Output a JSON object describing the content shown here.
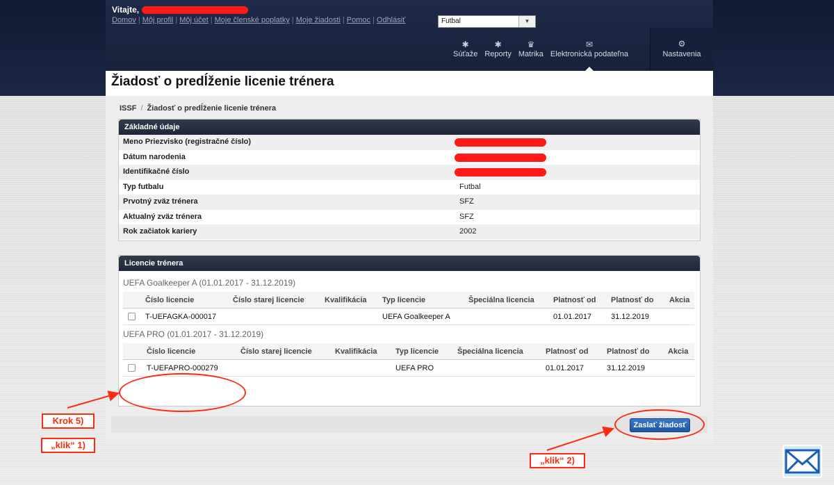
{
  "header": {
    "welcome": "Vitajte,",
    "links": [
      "Domov",
      "Môj profil",
      "Môj účet",
      "Moje členské poplatky",
      "Moje žiadosti",
      "Pomoc",
      "Odhlásiť"
    ],
    "sport_select": "Futbal"
  },
  "nav": {
    "items": [
      {
        "label": "Súťaže",
        "icon": "trophy-icon"
      },
      {
        "label": "Reporty",
        "icon": "chart-icon"
      },
      {
        "label": "Matrika",
        "icon": "registry-icon"
      },
      {
        "label": "Elektronická podateľna",
        "icon": "mail-icon"
      }
    ],
    "settings": {
      "label": "Nastavenia",
      "icon": "gear-icon"
    }
  },
  "page": {
    "title": "Žiadosť o predĺženie licenie trénera",
    "breadcrumb": {
      "root": "ISSF",
      "current": "Žiadosť o predĺženie licenie trénera"
    }
  },
  "basic": {
    "heading": "Základné údaje",
    "rows": [
      {
        "label": "Meno Priezvisko (registračné číslo)",
        "value": ""
      },
      {
        "label": "Dátum narodenia",
        "value": ""
      },
      {
        "label": "Identifikačné číslo",
        "value": ""
      },
      {
        "label": "Typ futbalu",
        "value": "Futbal"
      },
      {
        "label": "Prvotný zväz trénera",
        "value": "SFZ"
      },
      {
        "label": "Aktualný zväz trénera",
        "value": "SFZ"
      },
      {
        "label": "Rok začiatok kariery",
        "value": "2002"
      }
    ]
  },
  "licenses": {
    "heading": "Licencie trénera",
    "columns": [
      "Číslo licencie",
      "Číslo starej licencie",
      "Kvalifikácia",
      "Typ licencie",
      "Špeciálna licencia",
      "Platnosť od",
      "Platnosť do",
      "Akcia"
    ],
    "groups": [
      {
        "title": "UEFA Goalkeeper A (01.01.2017 - 31.12.2019)",
        "row": {
          "number": "T-UEFAGKA-000017",
          "old": "",
          "qualification": "",
          "type": "UEFA Goalkeeper A",
          "special": "",
          "from": "01.01.2017",
          "to": "31.12.2019"
        }
      },
      {
        "title": "UEFA PRO (01.01.2017 - 31.12.2019)",
        "row": {
          "number": "T-UEFAPRO-000279",
          "old": "",
          "qualification": "",
          "type": "UEFA PRO",
          "special": "",
          "from": "01.01.2017",
          "to": "31.12.2019"
        }
      }
    ]
  },
  "submit_label": "Zaslať žiadosť",
  "annotations": {
    "step": "Krok 5)",
    "click1": "„klik“ 1)",
    "click2": "„klik“ 2)",
    "color": "#ff2a12"
  }
}
